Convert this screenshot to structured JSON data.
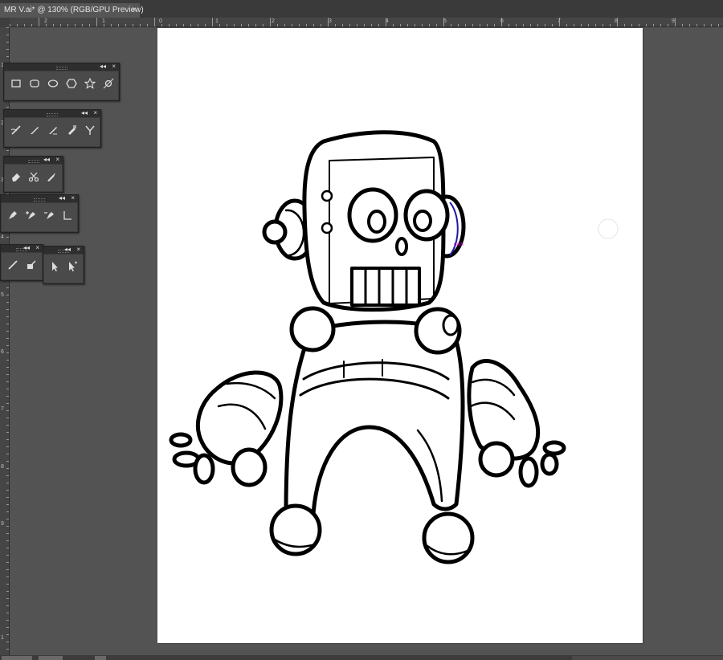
{
  "document_tab": {
    "title": "MR V.ai* @ 130% (RGB/GPU Preview)",
    "close_symbol": "×"
  },
  "rulers": {
    "horizontal_labels": [
      "2",
      "1",
      "0",
      "1",
      "2",
      "3",
      "4",
      "5",
      "6",
      "7",
      "8",
      "9"
    ],
    "vertical_labels": [
      "1",
      "2",
      "3",
      "4",
      "5",
      "6",
      "7",
      "8",
      "9",
      "1"
    ]
  },
  "panels": {
    "shapes": {
      "tools": [
        "rectangle-icon",
        "rounded-rectangle-icon",
        "ellipse-icon",
        "polygon-icon",
        "star-icon",
        "flare-icon"
      ]
    },
    "paint": {
      "tools": [
        "paintbrush-icon",
        "pencil-icon",
        "smooth-icon",
        "path-eraser-icon",
        "join-icon"
      ]
    },
    "erase": {
      "tools": [
        "eraser-icon",
        "scissors-icon",
        "knife-icon"
      ]
    },
    "pen": {
      "tools": [
        "pen-icon",
        "add-anchor-icon",
        "delete-anchor-icon",
        "convert-anchor-icon"
      ]
    },
    "blob": {
      "tools": [
        "blob-brush-icon",
        "shaper-icon"
      ]
    },
    "select": {
      "tools": [
        "selection-icon",
        "direct-selection-icon"
      ]
    },
    "collapse_symbol": "◂◂",
    "close_symbol": "×"
  },
  "canvas": {
    "hint_label": "path",
    "hint_color": "#cc00cc",
    "selection_color": "#1a1aa8"
  }
}
